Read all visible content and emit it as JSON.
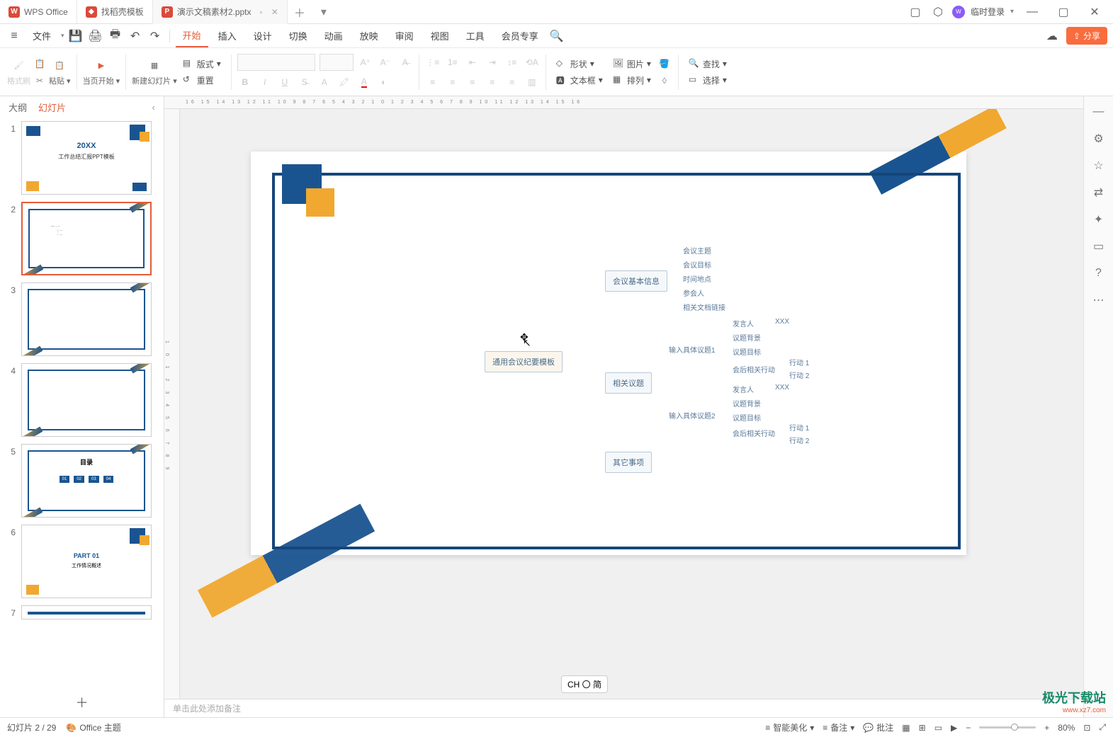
{
  "titlebar": {
    "app_name": "WPS Office",
    "tab_template": "找稻壳模板",
    "tab_doc": "演示文稿素材2.pptx",
    "login": "临时登录"
  },
  "menubar": {
    "file": "文件",
    "items": [
      "开始",
      "插入",
      "设计",
      "切换",
      "动画",
      "放映",
      "审阅",
      "视图",
      "工具",
      "会员专享"
    ],
    "share": "分享"
  },
  "ribbon": {
    "format_painter": "格式刷",
    "paste": "粘贴",
    "start_current": "当页开始",
    "new_slide": "新建幻灯片",
    "layout": "版式",
    "reset": "重置",
    "shape": "形状",
    "textbox": "文本框",
    "picture": "图片",
    "arrange": "排列",
    "find": "查找",
    "select": "选择"
  },
  "panel": {
    "tab_outline": "大纲",
    "tab_slides": "幻灯片",
    "slides": [
      {
        "num": "1",
        "title": "20XX",
        "sub": "工作总结汇报PPT模板"
      },
      {
        "num": "2"
      },
      {
        "num": "3"
      },
      {
        "num": "4"
      },
      {
        "num": "5",
        "title": "目录"
      },
      {
        "num": "6",
        "title": "PART 01",
        "sub": "工作情况概述"
      },
      {
        "num": "7"
      }
    ]
  },
  "ruler_h": "16 15 14 13 12 11 10 9 8 7 6 5 4 3 2 1 0 1 2 3 4 5 6 7 8 9 10 11 12 13 14 15 16",
  "ruler_v": "1 0 1 2 3 4 5 6 7 8 9",
  "canvas": {
    "root": "通用会议纪要模板",
    "l2": [
      "会议基本信息",
      "相关议题",
      "其它事项"
    ],
    "info_leaves": [
      "会议主题",
      "会议目标",
      "时间地点",
      "参会人",
      "相关文档链接"
    ],
    "topic1": "输入具体议题1",
    "topic2": "输入具体议题2",
    "topic_leaves": [
      "发言人",
      "议题背景",
      "议题目标",
      "会后相关行动"
    ],
    "xxx": "XXX",
    "action1": "行动 1",
    "action2": "行动 2"
  },
  "notes_placeholder": "单击此处添加备注",
  "ime": "CH 〇 简",
  "statusbar": {
    "slide_info": "幻灯片 2 / 29",
    "theme": "Office 主题",
    "beautify": "智能美化",
    "notes": "备注",
    "comments": "批注",
    "zoom": "80%"
  },
  "watermark": {
    "name": "极光下载站",
    "url": "www.xz7.com"
  }
}
